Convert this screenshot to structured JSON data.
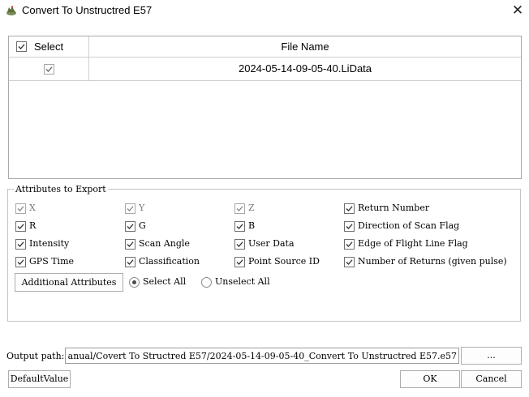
{
  "window": {
    "title": "Convert To Unstructred E57",
    "close_glyph": "✕"
  },
  "file_table": {
    "headers": {
      "select": "Select",
      "file_name": "File Name"
    },
    "rows": [
      {
        "checked": true,
        "file_name": "2024-05-14-09-05-40.LiData"
      }
    ]
  },
  "attributes": {
    "group_label": "Attributes to Export",
    "items": [
      {
        "label": "X",
        "checked": true,
        "enabled": false
      },
      {
        "label": "Y",
        "checked": true,
        "enabled": false
      },
      {
        "label": "Z",
        "checked": true,
        "enabled": false
      },
      {
        "label": "Return Number",
        "checked": true,
        "enabled": true
      },
      {
        "label": "R",
        "checked": true,
        "enabled": true
      },
      {
        "label": "G",
        "checked": true,
        "enabled": true
      },
      {
        "label": "B",
        "checked": true,
        "enabled": true
      },
      {
        "label": "Direction of Scan Flag",
        "checked": true,
        "enabled": true
      },
      {
        "label": "Intensity",
        "checked": true,
        "enabled": true
      },
      {
        "label": "Scan Angle",
        "checked": true,
        "enabled": true
      },
      {
        "label": "User Data",
        "checked": true,
        "enabled": true
      },
      {
        "label": "Edge of Flight Line Flag",
        "checked": true,
        "enabled": true
      },
      {
        "label": "GPS Time",
        "checked": true,
        "enabled": true
      },
      {
        "label": "Classification",
        "checked": true,
        "enabled": true
      },
      {
        "label": "Point Source ID",
        "checked": true,
        "enabled": true
      },
      {
        "label": "Number of Returns (given pulse)",
        "checked": true,
        "enabled": true
      }
    ],
    "additional_button": "Additional Attributes",
    "select_all": "Select All",
    "unselect_all": "Unselect All",
    "selected_radio": "select_all"
  },
  "output": {
    "label": "Output path:",
    "value": "anual/Covert To Structred E57/2024-05-14-09-05-40_Convert To Unstructred E57.e57",
    "browse_label": "..."
  },
  "footer": {
    "default_button": "DefaultValue",
    "ok_button": "OK",
    "cancel_button": "Cancel"
  }
}
